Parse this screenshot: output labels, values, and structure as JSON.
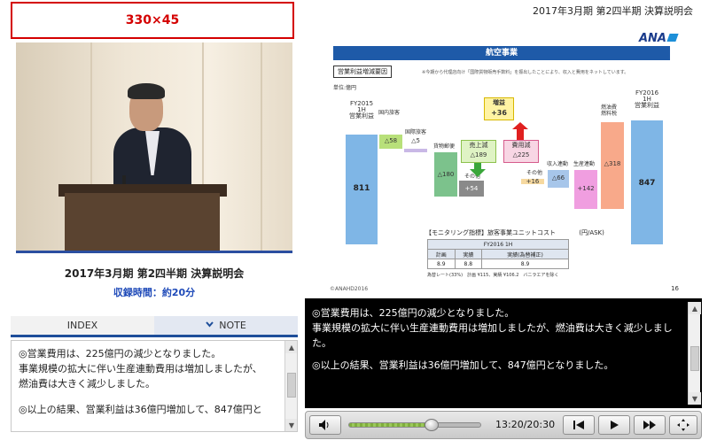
{
  "ad_banner": {
    "label": "330×45"
  },
  "session": {
    "title": "2017年3月期 第2四半期 決算説明会",
    "duration": "収録時間：約20分"
  },
  "tabs": [
    {
      "label": "INDEX",
      "active": false
    },
    {
      "label": "NOTE",
      "active": true,
      "icon": "chevron-down-icon"
    }
  ],
  "note": {
    "lines": [
      "◎営業費用は、225億円の減少となりました。",
      "事業規模の拡大に伴い生産連動費用は増加しましたが、",
      "燃油費は大きく減少しました。",
      "◎以上の結果、営業利益は36億円増加して、847億円と"
    ]
  },
  "header": {
    "title": "2017年3月期 第2四半期 決算説明会"
  },
  "slide": {
    "logo": "ANA",
    "banner": "航空事業",
    "section_label": "営業利益増減要因",
    "section_note": "※今期から代理店向け「国際貨物販売手数料」を振出したことにより、収入と費用をネットしています。",
    "unit": "単位:億円",
    "left_header": "FY2015\n1H\n営業利益",
    "right_header": "FY2016\n1H\n営業利益",
    "left_value": "811",
    "right_value": "847",
    "increase_label": "増益",
    "increase_value": "+36",
    "rev_down_label": "売上減",
    "rev_down_value": "△189",
    "cost_down_label": "費用減",
    "cost_down_value": "△225",
    "labels": {
      "intl_pax": "国内旅客",
      "intl_pax_value": "△58",
      "dom_pax": "国際旅客",
      "dom_pax_value": "△5",
      "cargo": "貨物郵便",
      "cargo_value": "△180",
      "other_rev": "その他",
      "other_rev_value": "+54",
      "other_cost": "その他",
      "other_cost_value": "+16",
      "rev_linked": "収入連動",
      "rev_linked_value": "△66",
      "prod_linked": "生産連動",
      "prod_linked_value": "+142",
      "fuel": "燃油費\n燃料税",
      "fuel_value": "△318"
    },
    "monitor": {
      "title": "【モニタリング指標】旅客事業ユニットコスト",
      "unit": "(円/ASK)",
      "period": "FY2016 1H",
      "headers": [
        "計画",
        "実績",
        "実績(為替補正)"
      ],
      "values": [
        "8.9",
        "8.8",
        "8.9"
      ],
      "footnote": "為替レート(33%)　計画 ¥115、実績 ¥106.2　バニラエアを除く"
    },
    "copyright": "©ANAHD2016",
    "page": "16"
  },
  "caption": {
    "lines": [
      "◎営業費用は、225億円の減少となりました。",
      "事業規模の拡大に伴い生産連動費用は増加しましたが、燃油費は大きく減少しました。",
      "◎以上の結果、営業利益は36億円増加して、847億円となりました。"
    ]
  },
  "player": {
    "time": "13:20/20:30",
    "progress": 0.63,
    "icons": [
      "volume-icon",
      "skip-back-icon",
      "play-icon",
      "fast-forward-icon",
      "fullscreen-icon"
    ]
  }
}
